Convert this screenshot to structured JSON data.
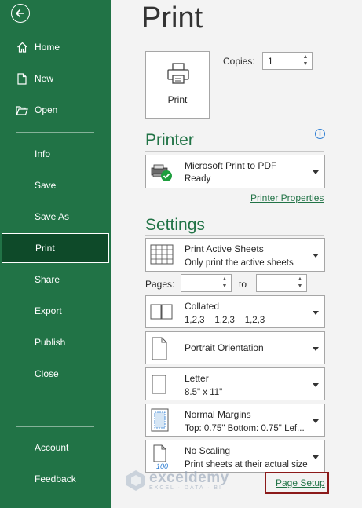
{
  "sidebar": {
    "items": [
      {
        "label": "Home",
        "icon": "home-icon"
      },
      {
        "label": "New",
        "icon": "new-document-icon"
      },
      {
        "label": "Open",
        "icon": "folder-open-icon"
      },
      {
        "label": "Info"
      },
      {
        "label": "Save"
      },
      {
        "label": "Save As"
      },
      {
        "label": "Print",
        "active": true
      },
      {
        "label": "Share"
      },
      {
        "label": "Export"
      },
      {
        "label": "Publish"
      },
      {
        "label": "Close"
      },
      {
        "label": "Account"
      },
      {
        "label": "Feedback"
      }
    ],
    "bg_color": "#217346",
    "active_color": "#0e4a29"
  },
  "main": {
    "title": "Print",
    "print_button_label": "Print",
    "copies_label": "Copies:",
    "copies_value": "1",
    "printer": {
      "heading": "Printer",
      "name": "Microsoft Print to PDF",
      "status": "Ready",
      "properties_link": "Printer Properties"
    },
    "settings": {
      "heading": "Settings",
      "print_what": {
        "title": "Print Active Sheets",
        "sub": "Only print the active sheets"
      },
      "pages_label": "Pages:",
      "to_label": "to",
      "collation": {
        "title": "Collated",
        "sub": "1,2,3    1,2,3    1,2,3"
      },
      "orientation": {
        "title": "Portrait Orientation"
      },
      "paper": {
        "title": "Letter",
        "sub": "8.5\" x 11\""
      },
      "margins": {
        "title": "Normal Margins",
        "sub": "Top: 0.75\" Bottom: 0.75\" Lef..."
      },
      "scaling": {
        "title": "No Scaling",
        "sub": "Print sheets at their actual size",
        "icon_text": "100"
      },
      "page_setup_link": "Page Setup"
    }
  },
  "watermark": {
    "name": "exceldemy",
    "tagline": "EXCEL · DATA · BI"
  },
  "colors": {
    "accent": "#217346",
    "highlight_box": "#8b1a1a",
    "info": "#2b7cd3"
  }
}
